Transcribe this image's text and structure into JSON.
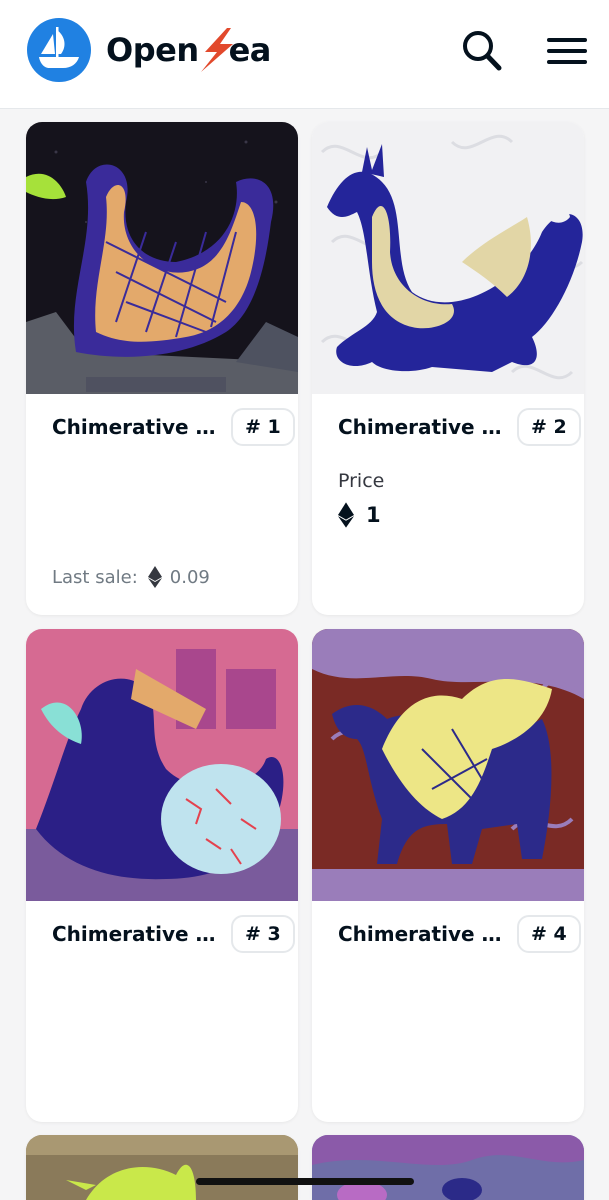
{
  "app": {
    "brand_prefix": "Open",
    "brand_suffix": "ea",
    "logo_icon": "opensea-boat-icon",
    "bolt_icon": "lightning-bolt-icon",
    "brand_color": "#2081e2",
    "bolt_color": "#e2492c"
  },
  "header": {
    "search_icon": "search-icon",
    "menu_icon": "hamburger-menu-icon"
  },
  "cards": [
    {
      "title": "Chimerative M...",
      "number": "# 1",
      "last_sale_label": "Last sale:",
      "last_sale_value": "0.09"
    },
    {
      "title": "Chimerative ...",
      "number": "# 2",
      "price_label": "Price",
      "price_value": "1"
    },
    {
      "title": "Chimerative ...",
      "number": "# 3"
    },
    {
      "title": "Chimerative ...",
      "number": "# 4"
    }
  ],
  "currency_icon": "ethereum-icon"
}
